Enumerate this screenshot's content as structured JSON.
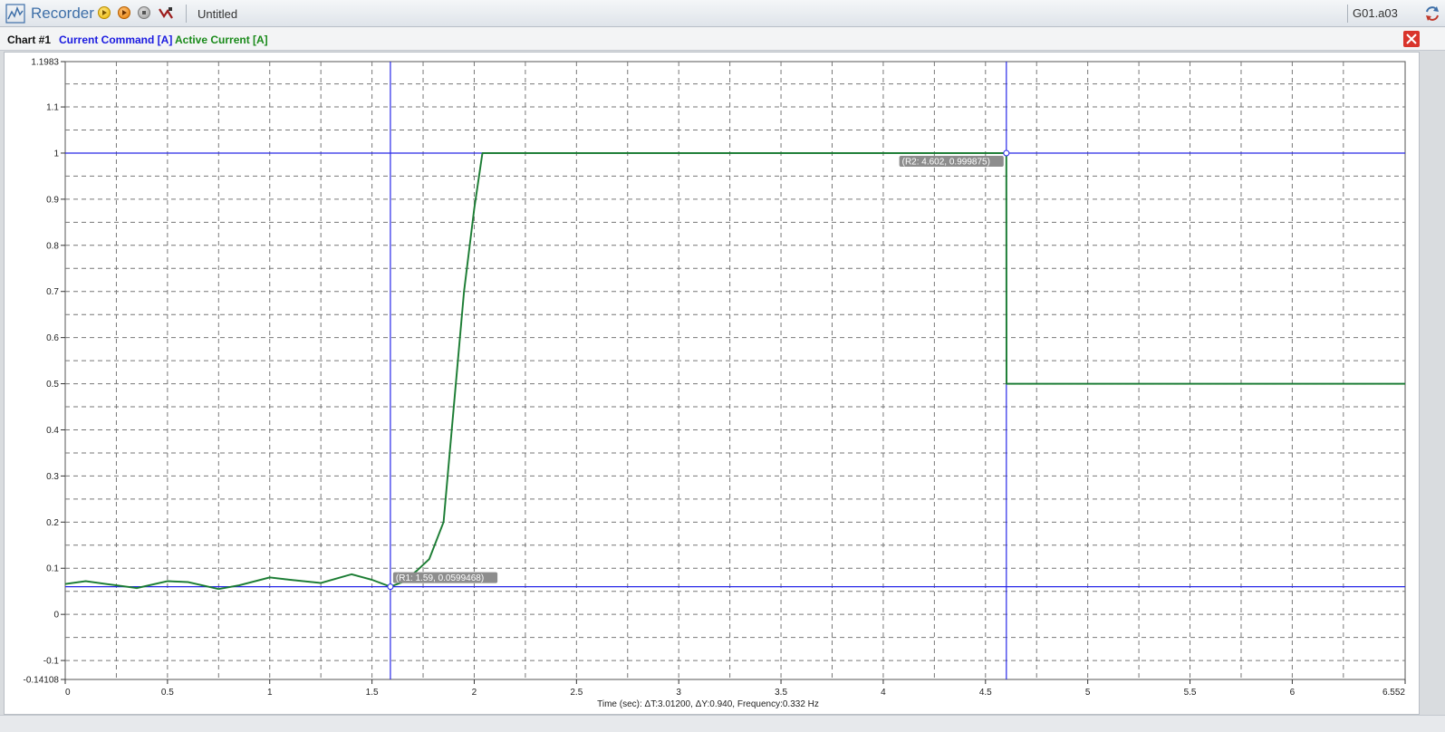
{
  "app": {
    "title": "Recorder",
    "document": "Untitled",
    "drive": "G01.a03"
  },
  "toolbar": {
    "icons": [
      "recorder-app-icon",
      "play-icon",
      "record-icon",
      "stop-icon",
      "trigger-icon",
      "sync-icon"
    ]
  },
  "chart_panel": {
    "name": "Chart #1",
    "legend": [
      {
        "label": "Current Command [A]",
        "color": "#1a1ae0"
      },
      {
        "label": "Active Current [A]",
        "color": "#1a8a1a"
      }
    ]
  },
  "chart_data": {
    "type": "line",
    "xlabel": "Time (sec): ΔT:3.01200, ΔY:0.940, Frequency:0.332 Hz",
    "ylabel": "",
    "xlim": [
      0,
      6.552
    ],
    "ylim": [
      -0.14108,
      1.1983
    ],
    "x_ticks": [
      "0",
      "0.5",
      "1",
      "1.5",
      "2",
      "2.5",
      "3",
      "3.5",
      "4",
      "4.5",
      "5",
      "5.5",
      "6",
      "6.552"
    ],
    "y_ticks": [
      "1.1983",
      "1.1",
      "1",
      "0.9",
      "0.8",
      "0.7",
      "0.6",
      "0.5",
      "0.4",
      "0.3",
      "0.2",
      "0.1",
      "0",
      "-0.1",
      "-0.14108"
    ],
    "grid": true,
    "series": [
      {
        "name": "Current Command [A]",
        "color": "#1a1ae0",
        "x": [
          0,
          0.1,
          0.2,
          0.35,
          0.5,
          0.6,
          0.75,
          0.85,
          1.0,
          1.1,
          1.25,
          1.4,
          1.5,
          1.59,
          1.65,
          1.72,
          1.78,
          1.85,
          1.9,
          1.95,
          2.0,
          2.04,
          2.5,
          3.0,
          3.5,
          4.0,
          4.5,
          4.602,
          4.603,
          5.0,
          5.5,
          6.0,
          6.552
        ],
        "values": [
          0.066,
          0.072,
          0.066,
          0.057,
          0.072,
          0.07,
          0.055,
          0.063,
          0.08,
          0.075,
          0.068,
          0.087,
          0.075,
          0.06,
          0.07,
          0.095,
          0.12,
          0.2,
          0.45,
          0.7,
          0.88,
          1.0,
          1.0,
          1.0,
          1.0,
          1.0,
          1.0,
          1.0,
          0.5,
          0.5,
          0.5,
          0.5,
          0.5
        ]
      },
      {
        "name": "Active Current [A]",
        "color": "#1a8a1a",
        "x": [
          0,
          0.1,
          0.2,
          0.35,
          0.5,
          0.6,
          0.75,
          0.85,
          1.0,
          1.1,
          1.25,
          1.4,
          1.5,
          1.59,
          1.65,
          1.72,
          1.78,
          1.85,
          1.9,
          1.95,
          2.0,
          2.04,
          2.5,
          3.0,
          3.5,
          4.0,
          4.5,
          4.602,
          4.603,
          5.0,
          5.5,
          6.0,
          6.552
        ],
        "values": [
          0.066,
          0.072,
          0.066,
          0.057,
          0.072,
          0.07,
          0.055,
          0.063,
          0.08,
          0.075,
          0.068,
          0.087,
          0.075,
          0.06,
          0.07,
          0.095,
          0.12,
          0.2,
          0.45,
          0.7,
          0.88,
          1.0,
          1.0,
          1.0,
          1.0,
          1.0,
          1.0,
          1.0,
          0.5,
          0.5,
          0.5,
          0.5,
          0.5
        ]
      }
    ],
    "cursors": [
      {
        "label": "(R1: 1.59, 0.0599468)",
        "x": 1.59,
        "y": 0.0599468
      },
      {
        "label": "(R2: 4.602, 0.999875)",
        "x": 4.602,
        "y": 0.999875
      }
    ]
  }
}
